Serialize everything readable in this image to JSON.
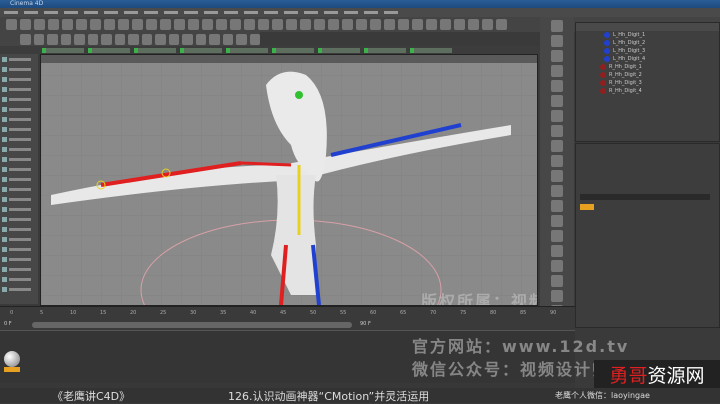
{
  "app": {
    "name": "Cinema 4D"
  },
  "timeline": {
    "ticks": [
      "0",
      "5",
      "10",
      "15",
      "20",
      "25",
      "30",
      "35",
      "40",
      "45",
      "50",
      "55",
      "60",
      "65",
      "70",
      "75",
      "80",
      "85",
      "90"
    ],
    "current_frame": "0 F",
    "end_frame": "90 F"
  },
  "objects": {
    "items": [
      "L_Hh_Digit_1",
      "L_Hh_Digit_2",
      "L_Hh_Digit_3",
      "L_Hh_Digit_4",
      "R_Hh_Digit_1",
      "R_Hh_Digit_2",
      "R_Hh_Digit_3",
      "R_Hh_Digit_4"
    ]
  },
  "watermark": {
    "line1": "版权所属：视频设计师老鹰",
    "line2": "官方网站：www.12d.tv",
    "line3": "微信公众号：视频设计师老鹰",
    "logo_red": "勇哥",
    "logo_white": "资源网"
  },
  "caption": {
    "series": "《老鹰讲C4D》",
    "lesson": "126.认识动画神器“CMotion”并灵活运用",
    "wechat": "老鹰个人微信：laoyingae"
  },
  "colors": {
    "accent_red": "#e02020",
    "accent_blue": "#2040d0",
    "joint_yellow": "#e8d020",
    "title_bar": "#2a5d96"
  }
}
